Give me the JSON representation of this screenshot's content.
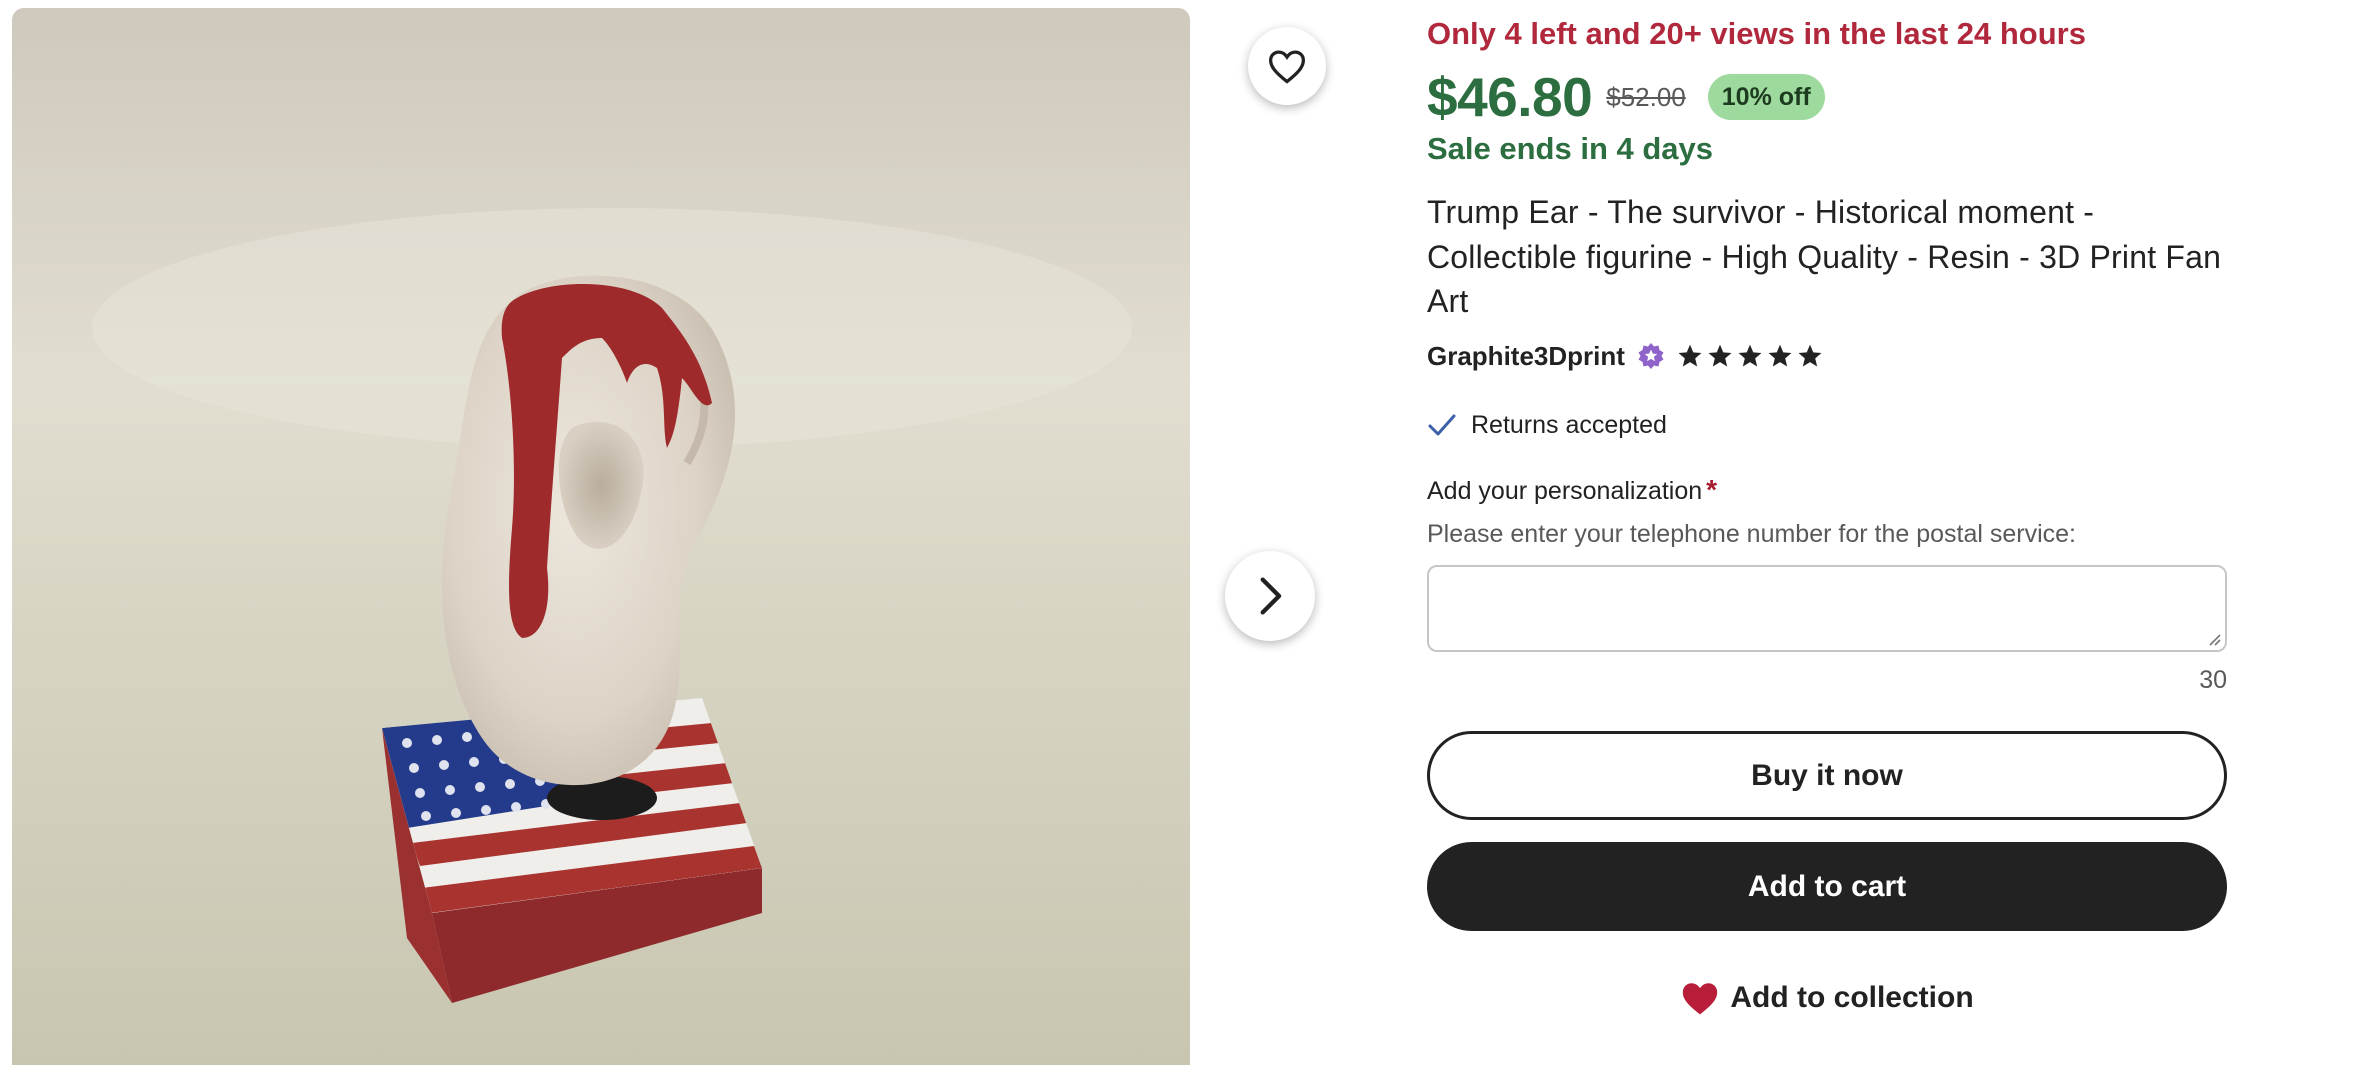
{
  "gallery": {
    "image_alt": "Resin ear figurine with red paint on an American flag base",
    "favorite_icon": "heart-outline-icon",
    "next_icon": "chevron-right-icon"
  },
  "listing": {
    "scarcity": "Only 4 left and 20+ views in the last 24 hours",
    "price": "$46.80",
    "original_price": "$52.00",
    "discount": "10% off",
    "sale_ends": "Sale ends in 4 days",
    "title": "Trump Ear - The survivor - Historical moment - Collectible figurine - High Quality - Resin - 3D Print Fan Art",
    "shop_name": "Graphite3Dprint",
    "shop_badge_icon": "star-seller-badge-icon",
    "rating": 5,
    "rating_max": 5,
    "returns": "Returns accepted",
    "returns_icon": "checkmark-icon"
  },
  "personalization": {
    "label": "Add your personalization",
    "required_marker": "*",
    "instructions": "Please enter your telephone number for the postal service:",
    "value": "",
    "char_count": "30"
  },
  "actions": {
    "buy_now": "Buy it now",
    "add_to_cart": "Add to cart",
    "add_to_collection": "Add to collection",
    "collection_icon": "heart-filled-icon"
  },
  "colors": {
    "scarcity": "#b1283c",
    "sale_green": "#2c6e3f",
    "discount_bg": "#9ed99e",
    "cart_bg": "#222222",
    "collection_heart": "#b81e3a",
    "star_seller_badge": "#8f63c9"
  }
}
